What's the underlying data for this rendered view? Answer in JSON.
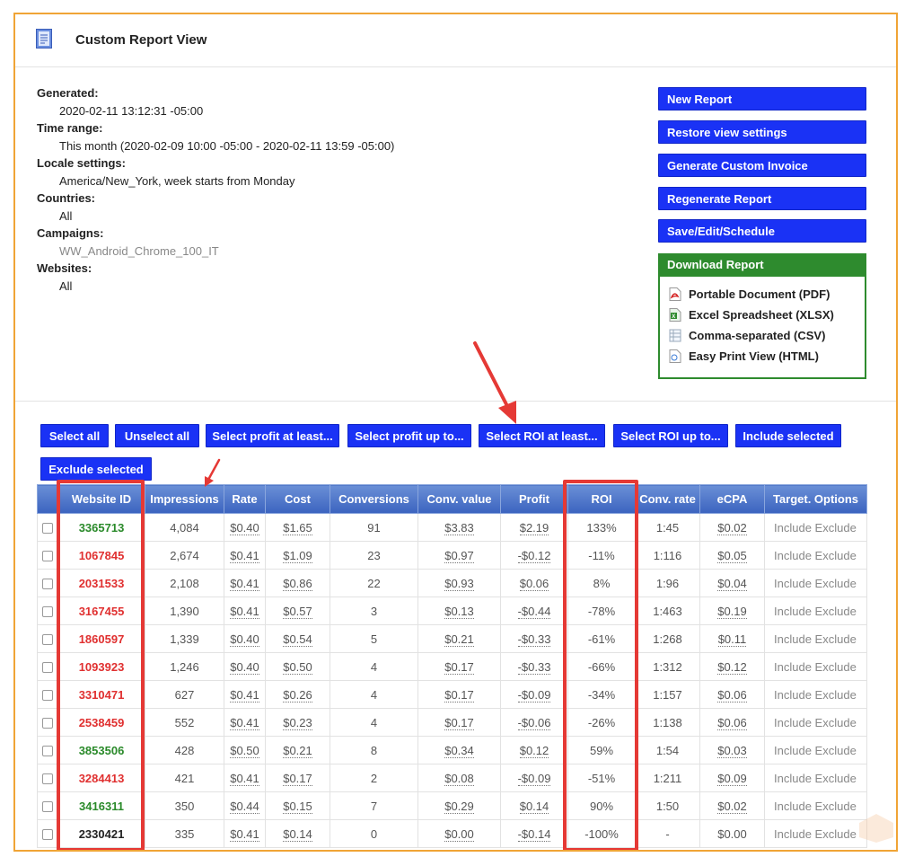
{
  "header": {
    "title": "Custom Report View",
    "icon": "report-icon"
  },
  "info": [
    {
      "label": "Generated:",
      "value": "2020-02-11 13:12:31 -05:00"
    },
    {
      "label": "Time range:",
      "value": "This month (2020-02-09 10:00 -05:00 - 2020-02-11 13:59 -05:00)"
    },
    {
      "label": "Locale settings:",
      "value": "America/New_York, week starts from Monday"
    },
    {
      "label": "Countries:",
      "value": "All"
    },
    {
      "label": "Campaigns:",
      "value": "WW_Android_Chrome_100_IT"
    },
    {
      "label": "Websites:",
      "value": "All"
    }
  ],
  "side_buttons": [
    "New Report",
    "Restore view settings",
    "Generate Custom Invoice",
    "Regenerate Report",
    "Save/Edit/Schedule"
  ],
  "download": {
    "title": "Download Report",
    "items": [
      "Portable Document (PDF)",
      "Excel Spreadsheet (XLSX)",
      "Comma-separated (CSV)",
      "Easy Print View (HTML)"
    ]
  },
  "actions": [
    "Select all",
    "Unselect all",
    "Select profit at least...",
    "Select profit up to...",
    "Select ROI at least...",
    "Select ROI up to...",
    "Include selected",
    "Exclude selected"
  ],
  "table": {
    "columns": [
      "Website ID",
      "Impressions",
      "Rate",
      "Cost",
      "Conversions",
      "Conv. value",
      "Profit",
      "ROI",
      "Conv. rate",
      "eCPA",
      "Target. Options"
    ],
    "option_labels": [
      "Include",
      "Exclude"
    ],
    "rows": [
      {
        "id": "3365713",
        "status": "green",
        "impressions": "4,084",
        "rate": "$0.40",
        "cost": "$1.65",
        "conversions": "91",
        "conv_value": "$3.83",
        "profit": "$2.19",
        "roi": "133%",
        "conv_rate": "1:45",
        "ecpa": "$0.02"
      },
      {
        "id": "1067845",
        "status": "red",
        "impressions": "2,674",
        "rate": "$0.41",
        "cost": "$1.09",
        "conversions": "23",
        "conv_value": "$0.97",
        "profit": "-$0.12",
        "roi": "-11%",
        "conv_rate": "1:116",
        "ecpa": "$0.05"
      },
      {
        "id": "2031533",
        "status": "red",
        "impressions": "2,108",
        "rate": "$0.41",
        "cost": "$0.86",
        "conversions": "22",
        "conv_value": "$0.93",
        "profit": "$0.06",
        "roi": "8%",
        "conv_rate": "1:96",
        "ecpa": "$0.04"
      },
      {
        "id": "3167455",
        "status": "red",
        "impressions": "1,390",
        "rate": "$0.41",
        "cost": "$0.57",
        "conversions": "3",
        "conv_value": "$0.13",
        "profit": "-$0.44",
        "roi": "-78%",
        "conv_rate": "1:463",
        "ecpa": "$0.19"
      },
      {
        "id": "1860597",
        "status": "red",
        "impressions": "1,339",
        "rate": "$0.40",
        "cost": "$0.54",
        "conversions": "5",
        "conv_value": "$0.21",
        "profit": "-$0.33",
        "roi": "-61%",
        "conv_rate": "1:268",
        "ecpa": "$0.11"
      },
      {
        "id": "1093923",
        "status": "red",
        "impressions": "1,246",
        "rate": "$0.40",
        "cost": "$0.50",
        "conversions": "4",
        "conv_value": "$0.17",
        "profit": "-$0.33",
        "roi": "-66%",
        "conv_rate": "1:312",
        "ecpa": "$0.12"
      },
      {
        "id": "3310471",
        "status": "red",
        "impressions": "627",
        "rate": "$0.41",
        "cost": "$0.26",
        "conversions": "4",
        "conv_value": "$0.17",
        "profit": "-$0.09",
        "roi": "-34%",
        "conv_rate": "1:157",
        "ecpa": "$0.06"
      },
      {
        "id": "2538459",
        "status": "red",
        "impressions": "552",
        "rate": "$0.41",
        "cost": "$0.23",
        "conversions": "4",
        "conv_value": "$0.17",
        "profit": "-$0.06",
        "roi": "-26%",
        "conv_rate": "1:138",
        "ecpa": "$0.06"
      },
      {
        "id": "3853506",
        "status": "green",
        "impressions": "428",
        "rate": "$0.50",
        "cost": "$0.21",
        "conversions": "8",
        "conv_value": "$0.34",
        "profit": "$0.12",
        "roi": "59%",
        "conv_rate": "1:54",
        "ecpa": "$0.03"
      },
      {
        "id": "3284413",
        "status": "red",
        "impressions": "421",
        "rate": "$0.41",
        "cost": "$0.17",
        "conversions": "2",
        "conv_value": "$0.08",
        "profit": "-$0.09",
        "roi": "-51%",
        "conv_rate": "1:211",
        "ecpa": "$0.09"
      },
      {
        "id": "3416311",
        "status": "green",
        "impressions": "350",
        "rate": "$0.44",
        "cost": "$0.15",
        "conversions": "7",
        "conv_value": "$0.29",
        "profit": "$0.14",
        "roi": "90%",
        "conv_rate": "1:50",
        "ecpa": "$0.02"
      },
      {
        "id": "2330421",
        "status": "black",
        "impressions": "335",
        "rate": "$0.41",
        "cost": "$0.14",
        "conversions": "0",
        "conv_value": "$0.00",
        "profit": "-$0.14",
        "roi": "-100%",
        "conv_rate": "-",
        "ecpa": "$0.00"
      }
    ]
  },
  "colors": {
    "button_blue": "#1a32f5",
    "download_green": "#2e8b2e",
    "highlight_red": "#e53935",
    "frame_orange": "#f0a436",
    "id_green": "#2a8a2a",
    "id_red": "#e03030",
    "id_black": "#222222"
  }
}
